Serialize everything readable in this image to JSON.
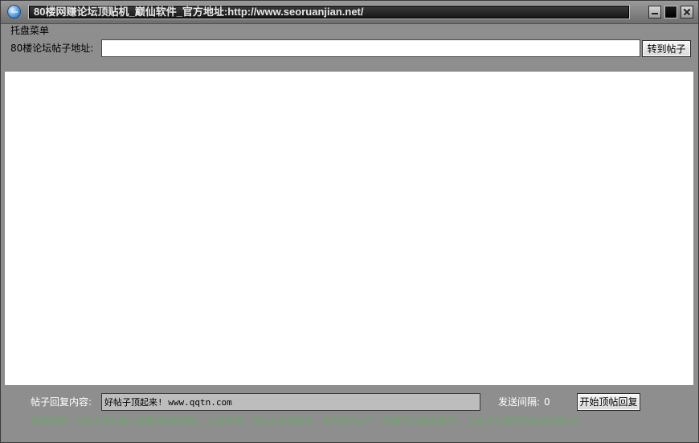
{
  "window": {
    "title": "80楼网赚论坛顶贴机_巅仙软件_官方地址:http://www.seoruanjian.net/"
  },
  "menu": {
    "tray_menu_label": "托盘菜单"
  },
  "url_bar": {
    "label": "80楼论坛帖子地址:",
    "value": "",
    "goto_button": "转到帖子"
  },
  "reply": {
    "label": "帖子回复内容:",
    "value": "好帖子顶起来! www.qqtn.com"
  },
  "interval": {
    "label": "发送间隔:",
    "value": "0"
  },
  "start_button": "开始顶帖回复",
  "instructions": "使用说明：在帖子地址输入需要顶帖的网址，点击转到，然后点击顶起来，软件就可以了（回复可以随意填写），让帖子在首页热帖排名第1位"
}
